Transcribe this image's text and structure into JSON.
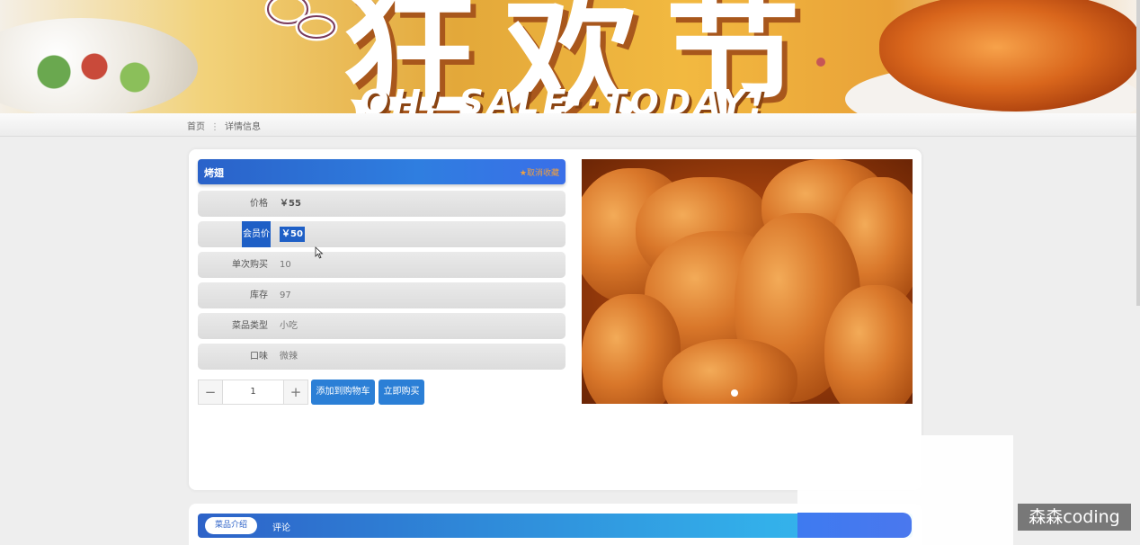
{
  "banner": {
    "title": "狂欢节",
    "subtitle": "OH! SALE··TODAY!"
  },
  "breadcrumb": {
    "home": "首页",
    "separator": "⋮",
    "current": "详情信息"
  },
  "product": {
    "name": "烤翅",
    "unfavorite": "★取消收藏",
    "fields": [
      {
        "label": "价格",
        "value": "￥55"
      },
      {
        "label": "会员价",
        "value": "￥50"
      },
      {
        "label": "单次购买",
        "value": "10"
      },
      {
        "label": "库存",
        "value": "97"
      },
      {
        "label": "菜品类型",
        "value": "小吃"
      },
      {
        "label": "口味",
        "value": "微辣"
      }
    ],
    "quantity": "1",
    "minus": "−",
    "plus": "+",
    "add_to_cart": "添加到购物车",
    "buy_now": "立即购买"
  },
  "tabs": {
    "intro": "菜品介绍",
    "comments": "评论"
  },
  "watermark": "森森coding",
  "colors": {
    "primary": "#2b7fd6",
    "title_bar": "#2a62c9",
    "favorite": "#f0a040"
  }
}
